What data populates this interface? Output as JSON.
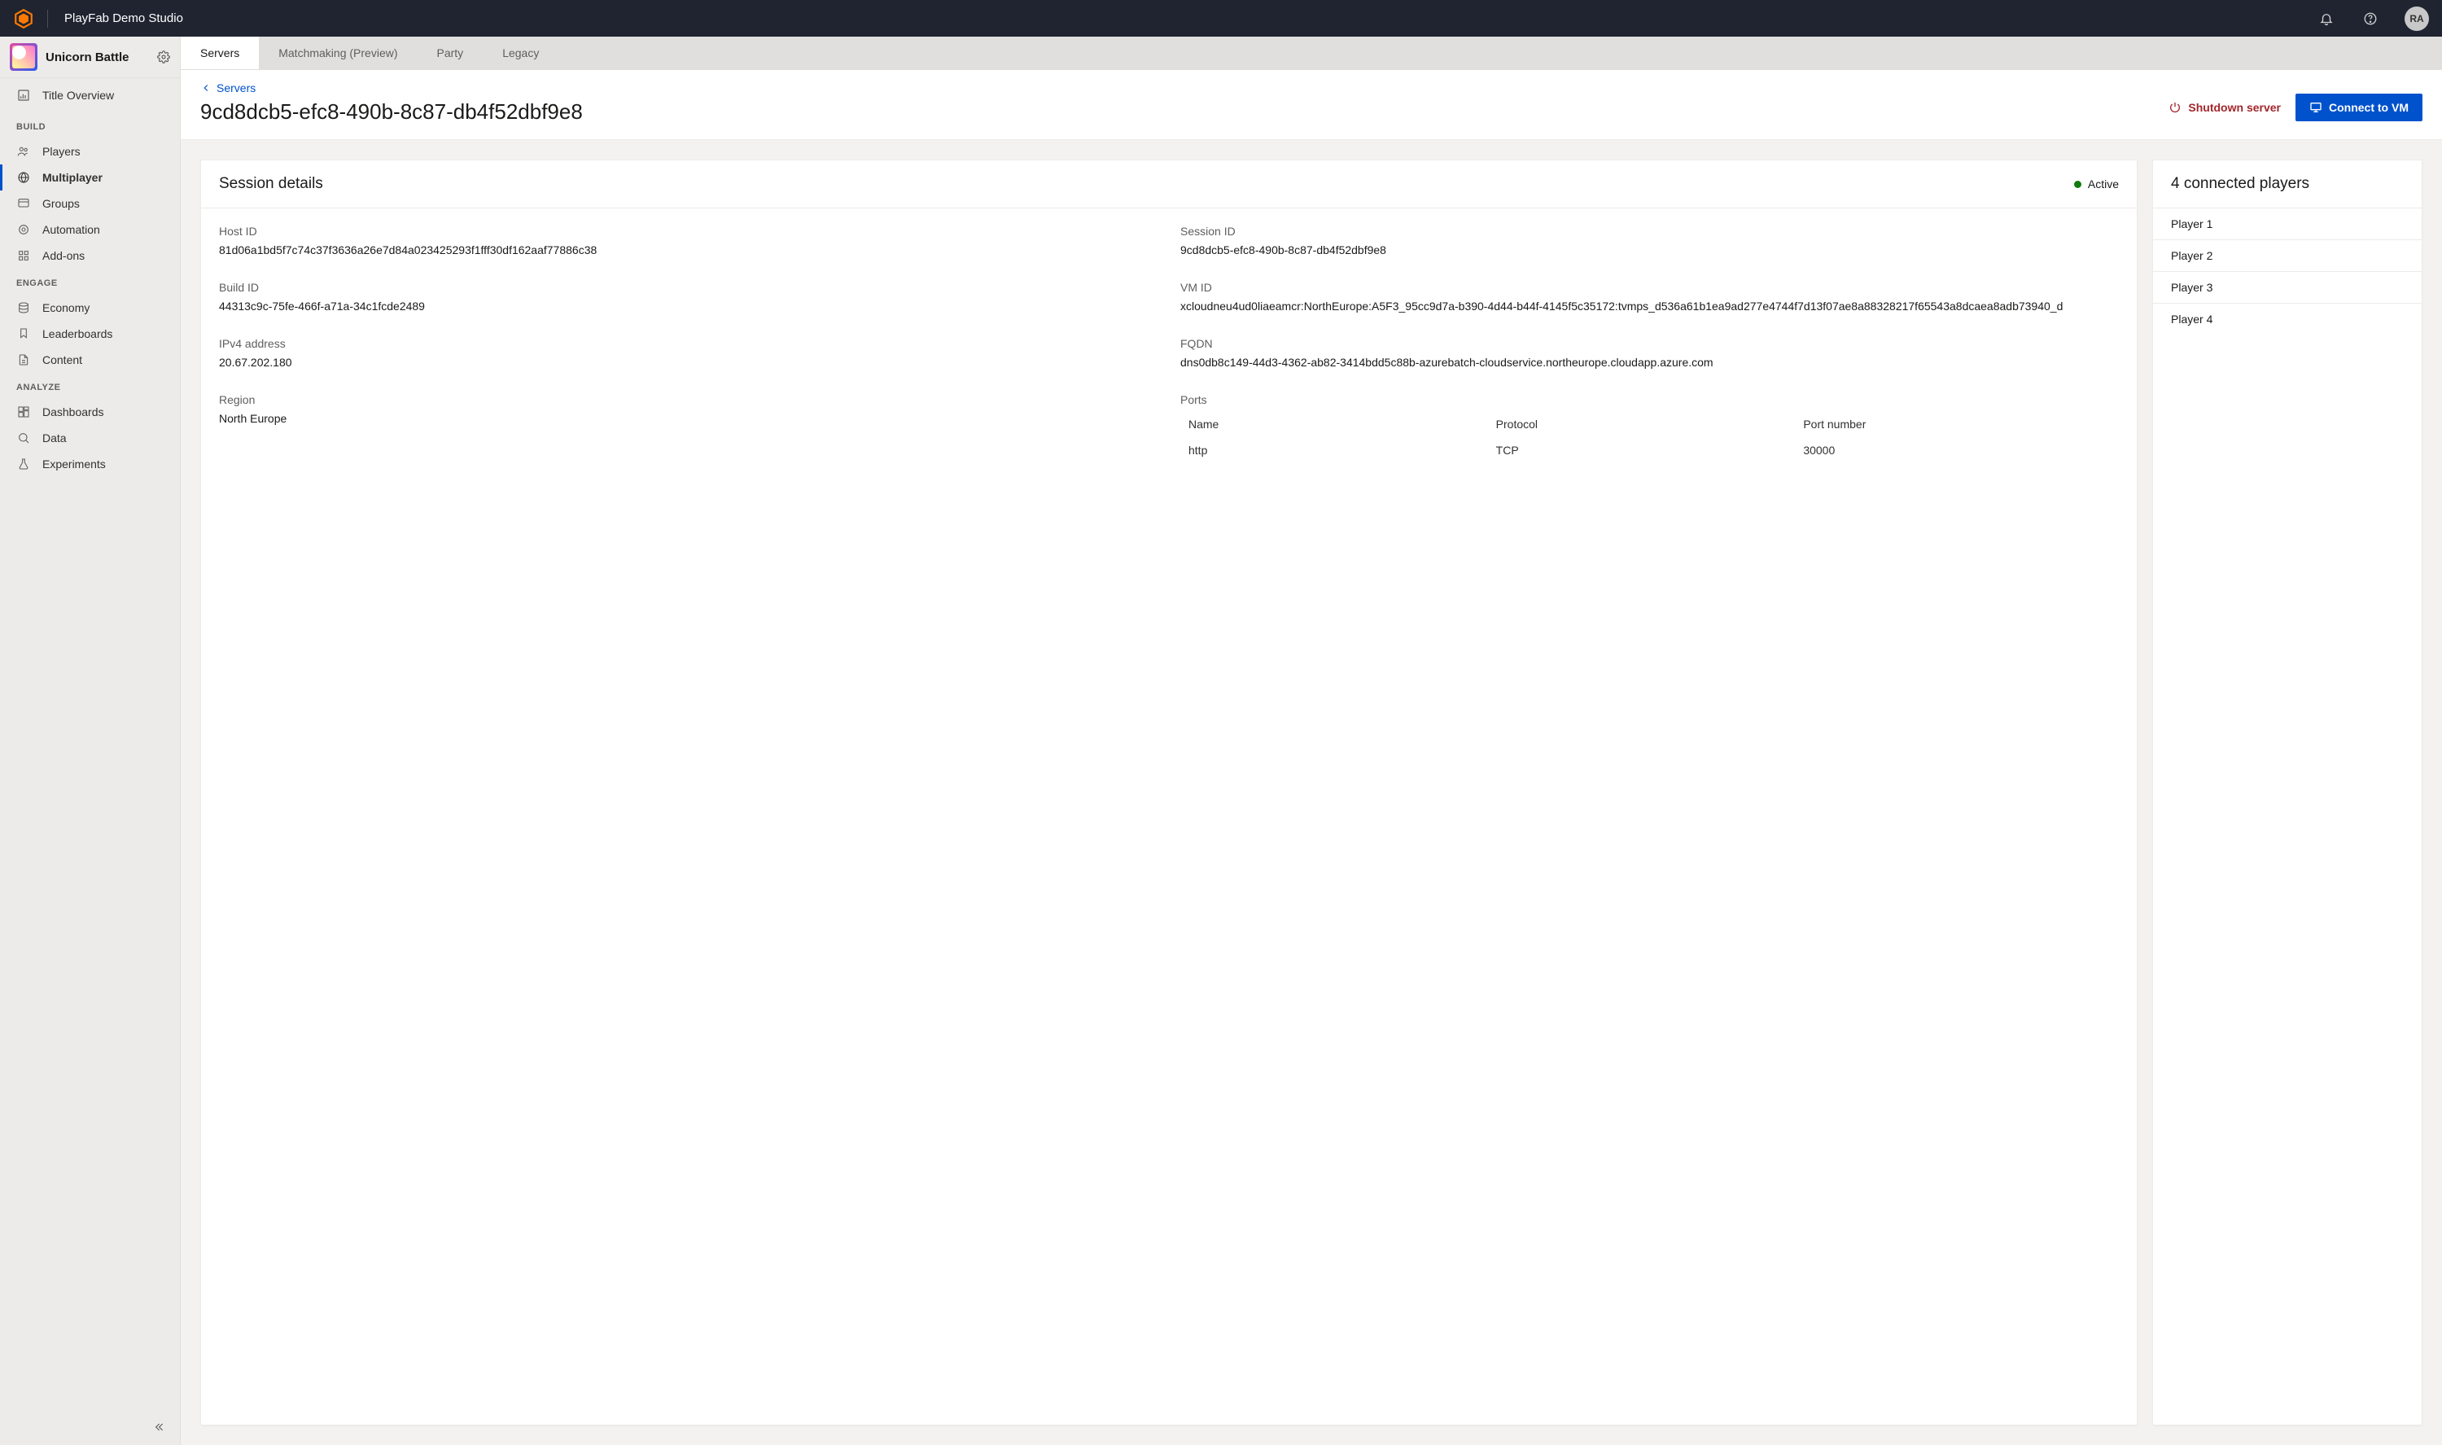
{
  "topbar": {
    "studio_name": "PlayFab Demo Studio",
    "avatar_initials": "RA"
  },
  "sidebar": {
    "game_title": "Unicorn Battle",
    "overview_label": "Title Overview",
    "sections": {
      "build": {
        "label": "BUILD",
        "items": [
          {
            "label": "Players"
          },
          {
            "label": "Multiplayer"
          },
          {
            "label": "Groups"
          },
          {
            "label": "Automation"
          },
          {
            "label": "Add-ons"
          }
        ]
      },
      "engage": {
        "label": "ENGAGE",
        "items": [
          {
            "label": "Economy"
          },
          {
            "label": "Leaderboards"
          },
          {
            "label": "Content"
          }
        ]
      },
      "analyze": {
        "label": "ANALYZE",
        "items": [
          {
            "label": "Dashboards"
          },
          {
            "label": "Data"
          },
          {
            "label": "Experiments"
          }
        ]
      }
    }
  },
  "tabs": [
    {
      "label": "Servers"
    },
    {
      "label": "Matchmaking (Preview)"
    },
    {
      "label": "Party"
    },
    {
      "label": "Legacy"
    }
  ],
  "header": {
    "breadcrumb": "Servers",
    "title": "9cd8dcb5-efc8-490b-8c87-db4f52dbf9e8",
    "shutdown_label": "Shutdown server",
    "connect_label": "Connect to VM"
  },
  "session_card": {
    "title": "Session details",
    "status_label": "Active",
    "status_color": "#107c10",
    "details": {
      "host_id": {
        "label": "Host ID",
        "value": "81d06a1bd5f7c74c37f3636a26e7d84a023425293f1fff30df162aaf77886c38"
      },
      "session_id": {
        "label": "Session ID",
        "value": "9cd8dcb5-efc8-490b-8c87-db4f52dbf9e8"
      },
      "build_id": {
        "label": "Build ID",
        "value": "44313c9c-75fe-466f-a71a-34c1fcde2489"
      },
      "vm_id": {
        "label": "VM ID",
        "value": "xcloudneu4ud0liaeamcr:NorthEurope:A5F3_95cc9d7a-b390-4d44-b44f-4145f5c35172:tvmps_d536a61b1ea9ad277e4744f7d13f07ae8a88328217f65543a8dcaea8adb73940_d"
      },
      "ipv4": {
        "label": "IPv4 address",
        "value": "20.67.202.180"
      },
      "fqdn": {
        "label": "FQDN",
        "value": "dns0db8c149-44d3-4362-ab82-3414bdd5c88b-azurebatch-cloudservice.northeurope.cloudapp.azure.com"
      },
      "region": {
        "label": "Region",
        "value": "North Europe"
      },
      "ports": {
        "label": "Ports",
        "columns": {
          "name": "Name",
          "protocol": "Protocol",
          "port": "Port number"
        },
        "rows": [
          {
            "name": "http",
            "protocol": "TCP",
            "port": "30000"
          }
        ]
      }
    }
  },
  "players_card": {
    "title": "4 connected players",
    "players": [
      {
        "label": "Player 1"
      },
      {
        "label": "Player 2"
      },
      {
        "label": "Player 3"
      },
      {
        "label": "Player 4"
      }
    ]
  }
}
